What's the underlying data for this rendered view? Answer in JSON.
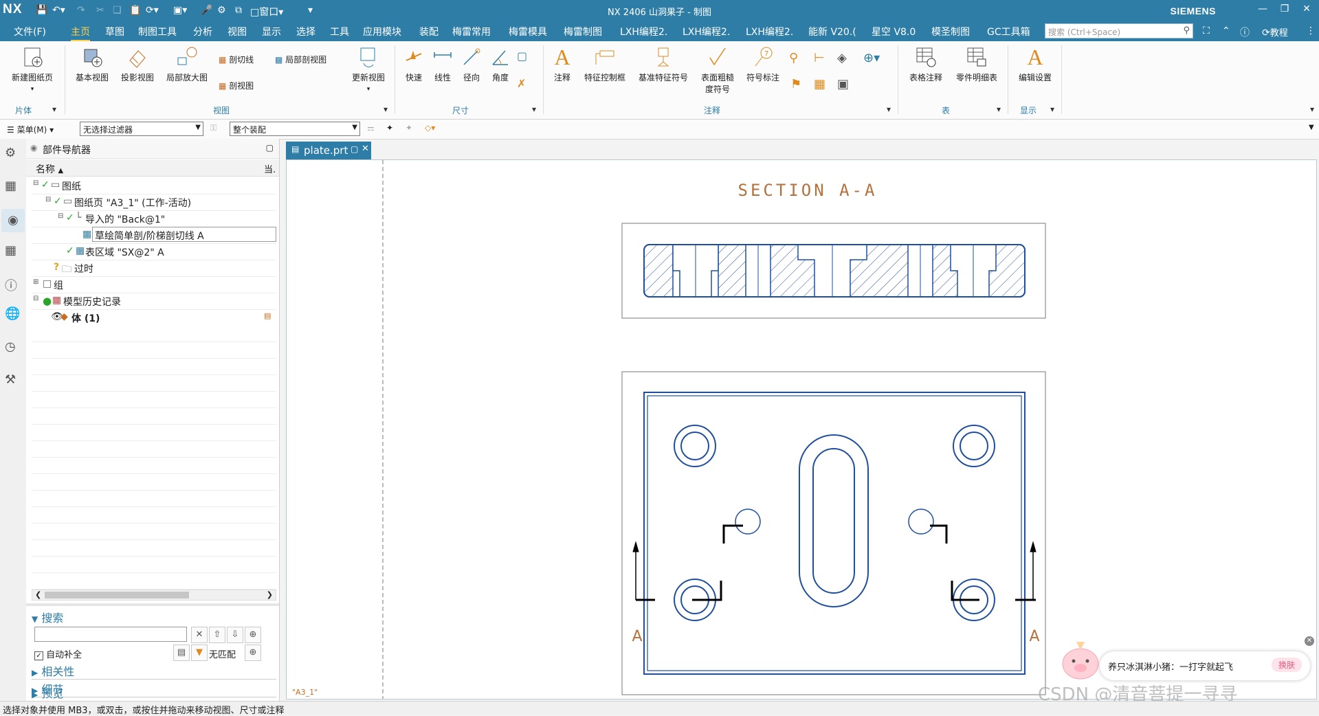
{
  "titlebar": {
    "app_logo": "NX",
    "window_menu": "窗口",
    "title": "NX 2406 山洞果子 - 制图",
    "brand": "SIEMENS"
  },
  "menubar": {
    "tabs": [
      "文件(F)",
      "主页",
      "草图",
      "制图工具",
      "分析",
      "视图",
      "显示",
      "选择",
      "工具",
      "应用模块",
      "装配",
      "梅雷常用",
      "梅雷模具",
      "梅雷制图",
      "LXH编程2.",
      "LXH编程2.",
      "LXH编程2.",
      "能新 V20.(",
      "星空 V8.0",
      "模圣制图",
      "GC工具箱"
    ],
    "active_tab": "主页",
    "search_placeholder": "搜索 (Ctrl+Space)",
    "tutorial": "教程"
  },
  "ribbon": {
    "new_sheet": "新建图纸页",
    "base_view": "基本视图",
    "projected_view": "投影视图",
    "detail_view": "局部放大图",
    "section_line": "剖切线",
    "break_out_section": "局部剖视图",
    "section_view": "剖视图",
    "update_views": "更新视图",
    "rapid": "快速",
    "linear": "线性",
    "radial": "径向",
    "angular": "角度",
    "note": "注释",
    "feature_control_frame": "特征控制框",
    "datum_feature_symbol": "基准特征符号",
    "surface_finish_1": "表面粗糙",
    "surface_finish_2": "度符号",
    "id_symbol": "符号标注",
    "tabular_note": "表格注释",
    "parts_list": "零件明细表",
    "edit_settings": "编辑设置",
    "group_sheet": "片体",
    "group_view": "视图",
    "group_dimension": "尺寸",
    "group_annotation": "注释",
    "group_table": "表",
    "group_display": "显示"
  },
  "filterbar": {
    "menu_label": "菜单(M)",
    "type_filter": "无选择过滤器",
    "scope_filter": "整个装配"
  },
  "navigator": {
    "title": "部件导航器",
    "col_name": "名称",
    "col_current": "当.",
    "rows": [
      "图纸",
      "图纸页 \"A3_1\" (工作-活动)",
      "导入的 \"Back@1\"",
      "草绘简单剖/阶梯剖切线 A",
      "表区域 \"SX@2\" A",
      "过时",
      "组",
      "模型历史记录",
      "体 (1)"
    ]
  },
  "search_panel": {
    "title": "搜索",
    "input_value": "",
    "autocomplete_label": "自动补全",
    "no_match_label": "无匹配",
    "sections": [
      "相关性",
      "细节",
      "预览"
    ]
  },
  "drawing": {
    "tab_label": "plate.prt",
    "section_title": "SECTION A-A",
    "section_label_left": "A",
    "section_label_right": "A",
    "sheet_name": "\"A3_1\""
  },
  "statusbar": {
    "message": "选择对象并使用 MB3，或双击，或按住并拖动来移动视图、尺寸或注释"
  },
  "popup": {
    "text": "养只冰淇淋小猪：一打字就起飞",
    "button": "换肤"
  },
  "watermark": "CSDN @清音菩提一寻寻",
  "colors": {
    "title_bar": "#2e7da7",
    "active_tab": "#ffd24a",
    "drawing_line": "#1f4e9c",
    "section_title": "#b5713d"
  }
}
